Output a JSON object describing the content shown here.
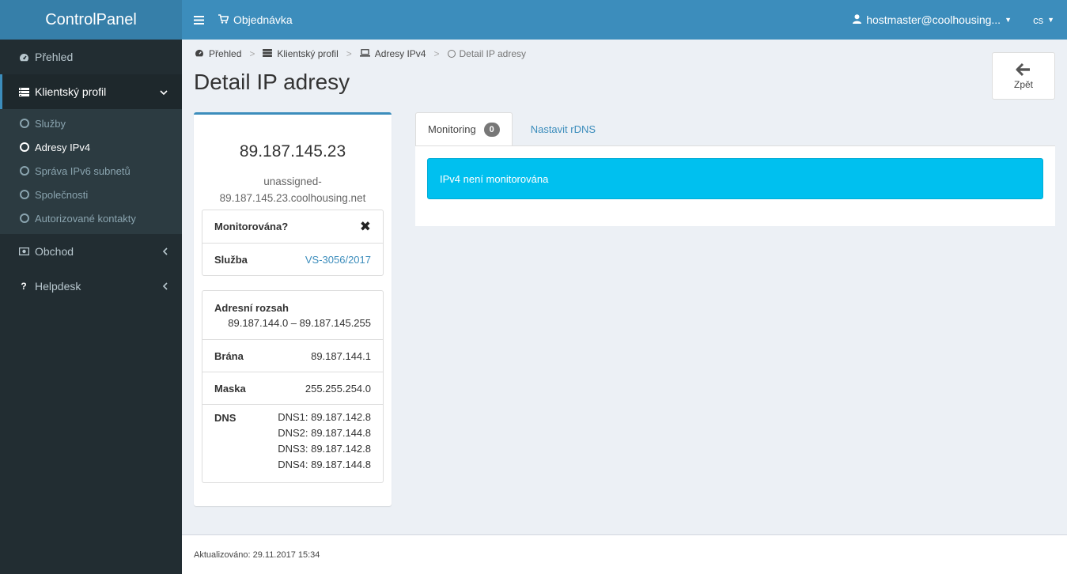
{
  "app": {
    "title": "ControlPanel"
  },
  "header": {
    "order_label": "Objednávka",
    "user_label": "hostmaster@coolhousing...",
    "lang_label": "cs"
  },
  "sidebar": {
    "items": [
      {
        "label": "Přehled",
        "icon": "dashboard-icon"
      },
      {
        "label": "Klientský profil",
        "icon": "list-icon"
      },
      {
        "label": "Obchod",
        "icon": "money-icon"
      },
      {
        "label": "Helpdesk",
        "icon": "question-icon"
      }
    ],
    "submenu": [
      {
        "label": "Služby"
      },
      {
        "label": "Adresy IPv4"
      },
      {
        "label": "Správa IPv6 subnetů"
      },
      {
        "label": "Společnosti"
      },
      {
        "label": "Autorizované kontakty"
      }
    ]
  },
  "breadcrumb": {
    "items": [
      "Přehled",
      "Klientský profil",
      "Adresy IPv4",
      "Detail IP adresy"
    ],
    "separator": ">"
  },
  "page": {
    "title": "Detail IP adresy",
    "back_label": "Zpět"
  },
  "ip": {
    "address": "89.187.145.23",
    "hostname_line1": "unassigned-",
    "hostname_line2": "89.187.145.23.coolhousing.net"
  },
  "status_box": {
    "monitored_label": "Monitorována?",
    "service_label": "Služba",
    "service_value": "VS-3056/2017"
  },
  "network_box": {
    "range_label": "Adresní rozsah",
    "range_value": "89.187.144.0 – 89.187.145.255",
    "gateway_label": "Brána",
    "gateway_value": "89.187.144.1",
    "mask_label": "Maska",
    "mask_value": "255.255.254.0",
    "dns_label": "DNS",
    "dns_values": [
      "DNS1: 89.187.142.8",
      "DNS2: 89.187.144.8",
      "DNS3: 89.187.142.8",
      "DNS4: 89.187.144.8"
    ]
  },
  "tabs": [
    {
      "label": "Monitoring",
      "badge": "0"
    },
    {
      "label": "Nastavit rDNS"
    }
  ],
  "alert": {
    "text": "IPv4 není monitorována"
  },
  "footer": {
    "text": "Aktualizováno: 29.11.2017 15:34"
  },
  "colors": {
    "accent": "#3c8dbc",
    "sidebar": "#222d32",
    "alert": "#00c0ef"
  }
}
